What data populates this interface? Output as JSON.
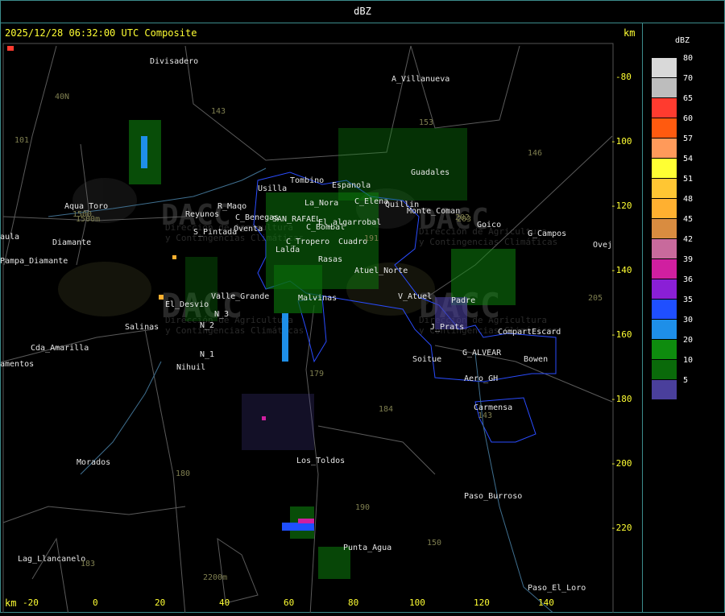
{
  "header": {
    "title": "dBZ"
  },
  "timestamp": "2025/12/28 06:32:00 UTC Composite",
  "axis": {
    "unit": "km",
    "x_ticks": [
      "-20",
      "0",
      "20",
      "40",
      "60",
      "80",
      "100",
      "120",
      "140"
    ],
    "y_ticks": [
      "-80",
      "-100",
      "-120",
      "-140",
      "-160",
      "-180",
      "-200",
      "-220"
    ]
  },
  "legend": {
    "title": "dBZ",
    "entries": [
      {
        "label": "80",
        "color": "#d9d9d9"
      },
      {
        "label": "70",
        "color": "#bdbdbd"
      },
      {
        "label": "65",
        "color": "#ff3b2f"
      },
      {
        "label": "60",
        "color": "#ff5a0f"
      },
      {
        "label": "57",
        "color": "#ff9a5a"
      },
      {
        "label": "54",
        "color": "#ffff33"
      },
      {
        "label": "51",
        "color": "#ffc633"
      },
      {
        "label": "48",
        "color": "#ffb030"
      },
      {
        "label": "45",
        "color": "#d98c40"
      },
      {
        "label": "42",
        "color": "#c86a9c"
      },
      {
        "label": "39",
        "color": "#d01fa0"
      },
      {
        "label": "36",
        "color": "#8a1fd6"
      },
      {
        "label": "35",
        "color": "#1f4fff"
      },
      {
        "label": "30",
        "color": "#1e8fe8"
      },
      {
        "label": "20",
        "color": "#0e8c0e"
      },
      {
        "label": "10",
        "color": "#0a6a0a"
      },
      {
        "label": "5",
        "color": "#4a3f9c"
      }
    ]
  },
  "places": [
    "Divisadero",
    "A_Villanueva",
    "40N",
    "101",
    "143",
    "Guadales",
    "Usilla",
    "Tombino",
    "Espanola",
    "Aqua_Toro",
    "1500m",
    "Reyunos",
    "S_Pintada",
    "La_Nora",
    "C_Elena",
    "Quillin",
    "SAN_RAFAEL",
    "El_algarrobal",
    "C_Bombal",
    "C_Tropero",
    "Cuadro",
    "Lalda",
    "Rasas",
    "Atuel_Norte",
    "Pampa_Diamante",
    "Diamante",
    "El_Desvio",
    "Valle_Grande",
    "Malvinas",
    "V_Atuel",
    "Salinas",
    "N_2",
    "N_3",
    "N_1",
    "Nihuil",
    "Cda_Amarilla",
    "amentos",
    "Soitue",
    "G_ALVEAR",
    "CompartEscard",
    "Bowen",
    "Aero_GH",
    "Carmensa",
    "179",
    "184",
    "180",
    "Los_Toldos",
    "Morados",
    "Paso_Burroso",
    "Punta_Agua",
    "Lag_Llancanelo",
    "2200m",
    "Paso_El_Loro",
    "146",
    "205",
    "Ovej",
    "G_Campos",
    "Monte_Coman",
    "Goico",
    "Padre",
    "J_Prats",
    "aula",
    "Oventa",
    "183",
    "153",
    "202",
    "191",
    "150",
    "203",
    "1500",
    "143",
    "190",
    "C_Benegas",
    "R_Maqo"
  ],
  "watermark": {
    "logo_text": "DACC",
    "line1": "Dirección de Agricultura",
    "line2": "y Contingencias Climáticas"
  }
}
